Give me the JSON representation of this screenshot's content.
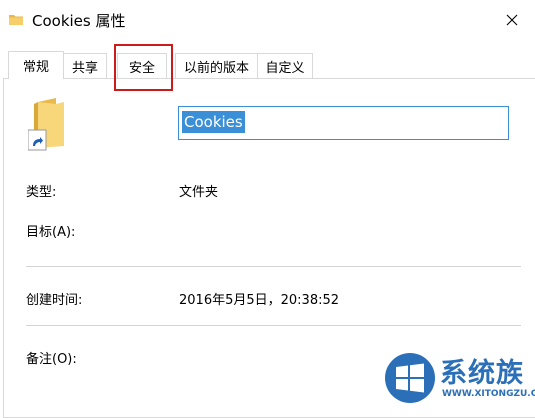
{
  "window": {
    "title": "Cookies 属性"
  },
  "tabs": [
    {
      "label": "常规",
      "active": true
    },
    {
      "label": "共享",
      "active": false
    },
    {
      "label": "安全",
      "active": false
    },
    {
      "label": "以前的版本",
      "active": false
    },
    {
      "label": "自定义",
      "active": false
    }
  ],
  "general": {
    "name_value": "Cookies",
    "type_label": "类型:",
    "type_value": "文件夹",
    "target_label": "目标(A):",
    "created_label": "创建时间:",
    "created_value": "2016年5月5日，20:38:52",
    "comment_label": "备注(O):"
  },
  "watermark": {
    "site_name": "系统族",
    "url": "WWW.XITONGZU.COM"
  },
  "colors": {
    "highlight_box": "#cc1b1b",
    "selection": "#3a8fd6",
    "watermark": "#2a6fb8"
  },
  "icons": [
    "folder-icon",
    "shortcut-arrow-icon",
    "close-icon",
    "windows-logo-icon"
  ]
}
